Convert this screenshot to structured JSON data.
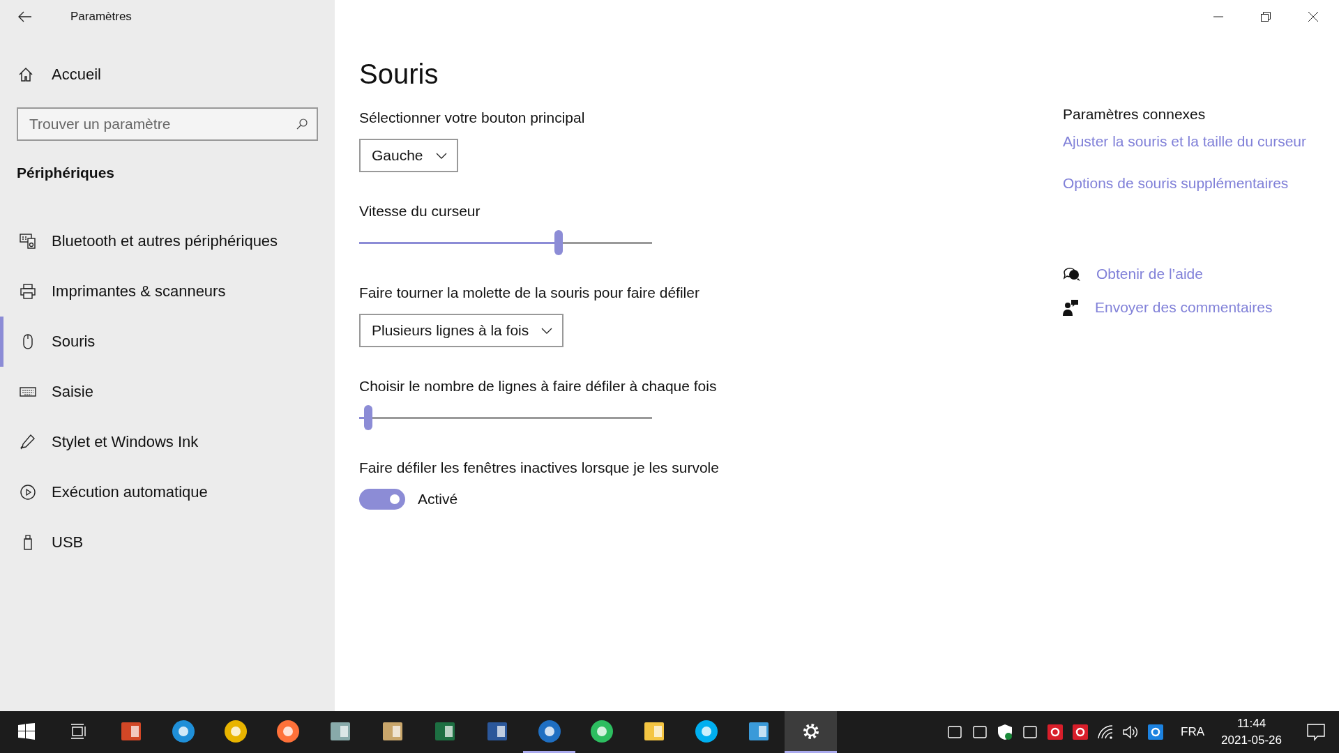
{
  "window": {
    "title": "Paramètres"
  },
  "sidebar": {
    "home": "Accueil",
    "search": {
      "placeholder": "Trouver un paramètre"
    },
    "section": "Périphériques",
    "items": [
      {
        "label": "Bluetooth et autres périphériques",
        "kind": "devices",
        "selected": false
      },
      {
        "label": "Imprimantes & scanneurs",
        "kind": "printer",
        "selected": false
      },
      {
        "label": "Souris",
        "kind": "mouse",
        "selected": true
      },
      {
        "label": "Saisie",
        "kind": "keyboard",
        "selected": false
      },
      {
        "label": "Stylet et Windows Ink",
        "kind": "pen",
        "selected": false
      },
      {
        "label": "Exécution automatique",
        "kind": "autoplay",
        "selected": false
      },
      {
        "label": "USB",
        "kind": "usb",
        "selected": false
      }
    ]
  },
  "page": {
    "title": "Souris",
    "settings": [
      {
        "kind": "dropdown",
        "label": "Sélectionner votre bouton principal",
        "value": "Gauche"
      },
      {
        "kind": "slider",
        "label": "Vitesse du curseur",
        "level": 0.68
      },
      {
        "kind": "dropdown",
        "label": "Faire tourner la molette de la souris pour faire défiler",
        "value": "Plusieurs lignes à la fois"
      },
      {
        "kind": "slider",
        "label": "Choisir le nombre de lignes à faire défiler à chaque fois",
        "level": 0.03
      },
      {
        "kind": "toggle",
        "label": "Faire défiler les fenêtres inactives lorsque je les survole",
        "on": true,
        "state_text": "Activé"
      }
    ]
  },
  "related": {
    "heading": "Paramètres connexes",
    "links": [
      "Ajuster la souris et la taille du curseur",
      "Options de souris supplémentaires"
    ],
    "help": [
      {
        "kind": "help",
        "label": "Obtenir de l’aide"
      },
      {
        "kind": "feedback",
        "label": "Envoyer des commentaires"
      }
    ]
  },
  "taskbar": {
    "apps": [
      {
        "kind": "start",
        "selected": false,
        "running": false
      },
      {
        "kind": "taskview",
        "selected": false,
        "running": false
      },
      {
        "kind": "powerpoint",
        "selected": false,
        "running": false
      },
      {
        "kind": "edge",
        "selected": false,
        "running": false
      },
      {
        "kind": "chrome",
        "selected": false,
        "running": false
      },
      {
        "kind": "firefox",
        "selected": false,
        "running": false
      },
      {
        "kind": "scanner",
        "selected": false,
        "running": false
      },
      {
        "kind": "paint",
        "selected": false,
        "running": false
      },
      {
        "kind": "excel",
        "selected": false,
        "running": false
      },
      {
        "kind": "word",
        "selected": false,
        "running": false
      },
      {
        "kind": "mail",
        "selected": false,
        "running": true
      },
      {
        "kind": "evernote",
        "selected": false,
        "running": false
      },
      {
        "kind": "folder",
        "selected": false,
        "running": false
      },
      {
        "kind": "skype",
        "selected": false,
        "running": false
      },
      {
        "kind": "panel",
        "selected": false,
        "running": false
      },
      {
        "kind": "settings",
        "selected": true,
        "running": true
      }
    ],
    "tray": [
      {
        "kind": "camera"
      },
      {
        "kind": "sync"
      },
      {
        "kind": "shield"
      },
      {
        "kind": "usb"
      },
      {
        "kind": "antivirus"
      },
      {
        "kind": "dropbox"
      },
      {
        "kind": "wifi"
      },
      {
        "kind": "volume"
      },
      {
        "kind": "remote"
      }
    ],
    "language": "FRA",
    "time": "11:44",
    "date": "2021-05-26"
  }
}
